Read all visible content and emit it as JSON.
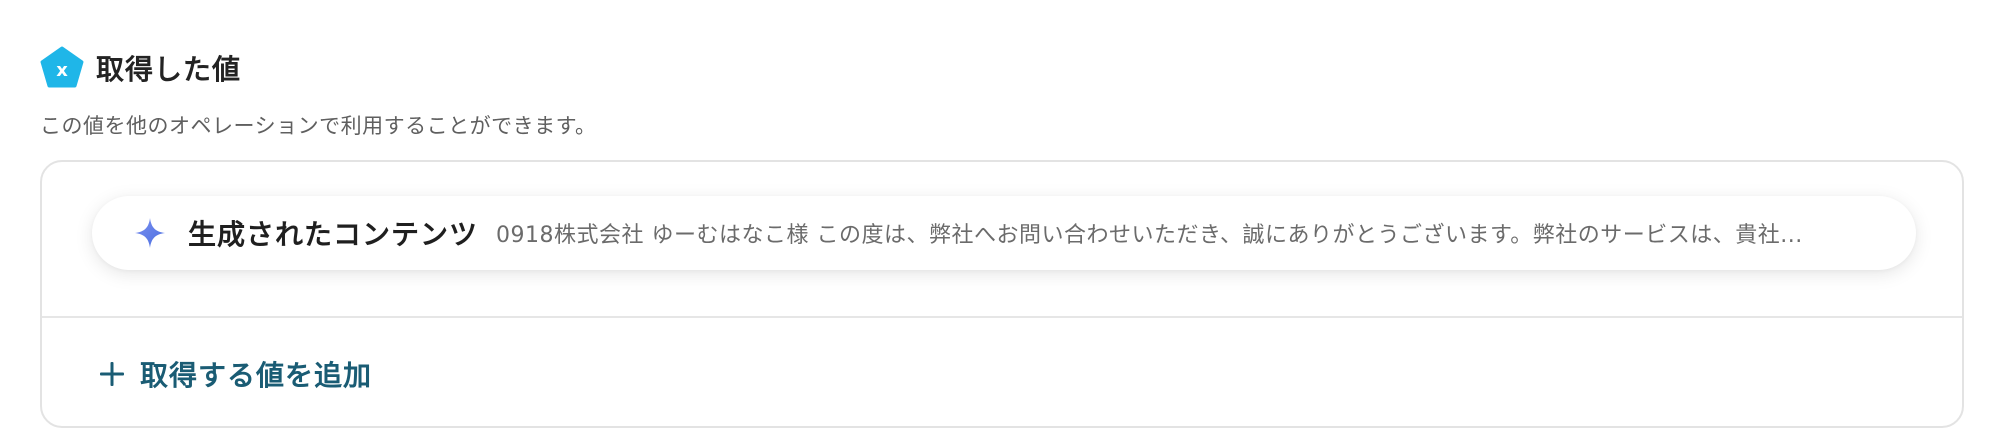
{
  "header": {
    "badge_icon": "variable-x-icon",
    "badge_color": "#1fb6e8",
    "title": "取得した値"
  },
  "description": "この値を他のオペレーションで利用することができます。",
  "values": [
    {
      "icon": "sparkle-icon",
      "name": "生成されたコンテンツ",
      "preview": "0918株式会社 ゆーむはなこ様 この度は、弊社へお問い合わせいただき、誠にありがとうございます。弊社のサービスは、貴社..."
    }
  ],
  "add_button": {
    "icon": "plus-icon",
    "label": "取得する値を追加",
    "color": "#1a5c74"
  }
}
